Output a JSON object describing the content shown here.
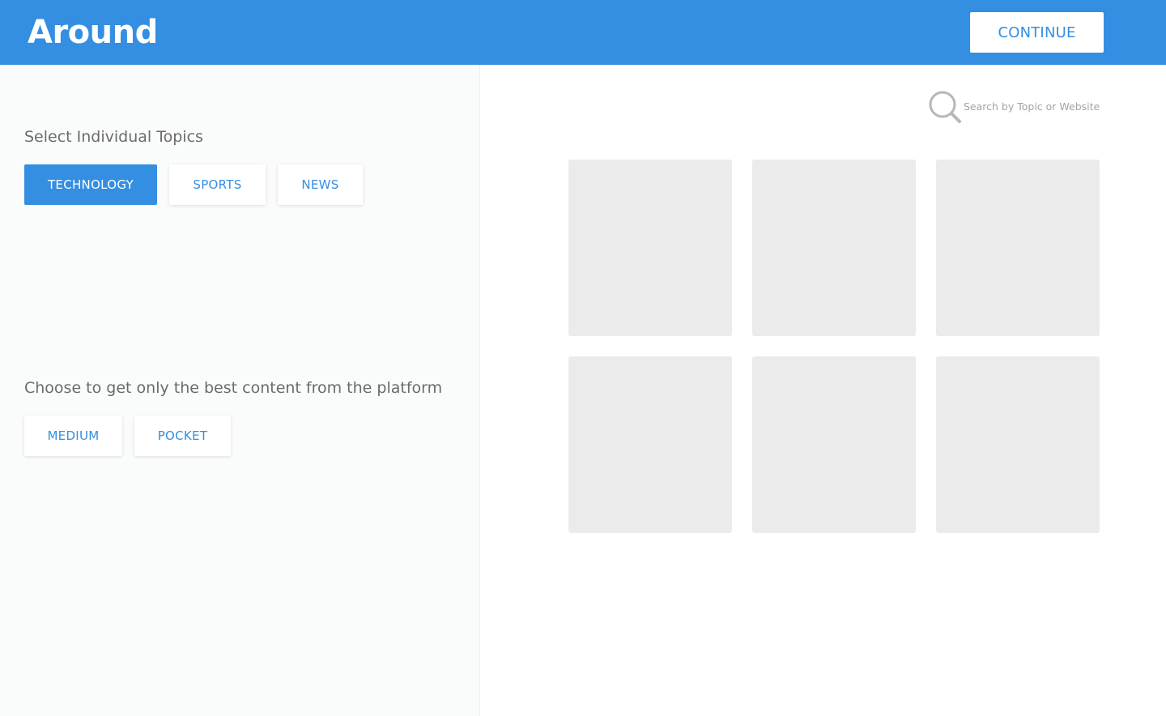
{
  "header": {
    "logo": "Around",
    "continue_label": "CONTINUE"
  },
  "topics": {
    "title": "Select Individual Topics",
    "items": [
      {
        "label": "TECHNOLOGY",
        "active": true
      },
      {
        "label": "SPORTS",
        "active": false
      },
      {
        "label": "NEWS",
        "active": false
      }
    ]
  },
  "platforms": {
    "title": "Choose to get only the best content from the platform",
    "items": [
      {
        "label": "MEDIUM",
        "active": false
      },
      {
        "label": "POCKET",
        "active": false
      }
    ]
  },
  "search": {
    "placeholder": "Search by Topic or Website",
    "icon": "search-icon"
  },
  "colors": {
    "accent": "#348ee1",
    "tile": "#ebebeb",
    "left_panel_bg": "#fafcfc"
  }
}
